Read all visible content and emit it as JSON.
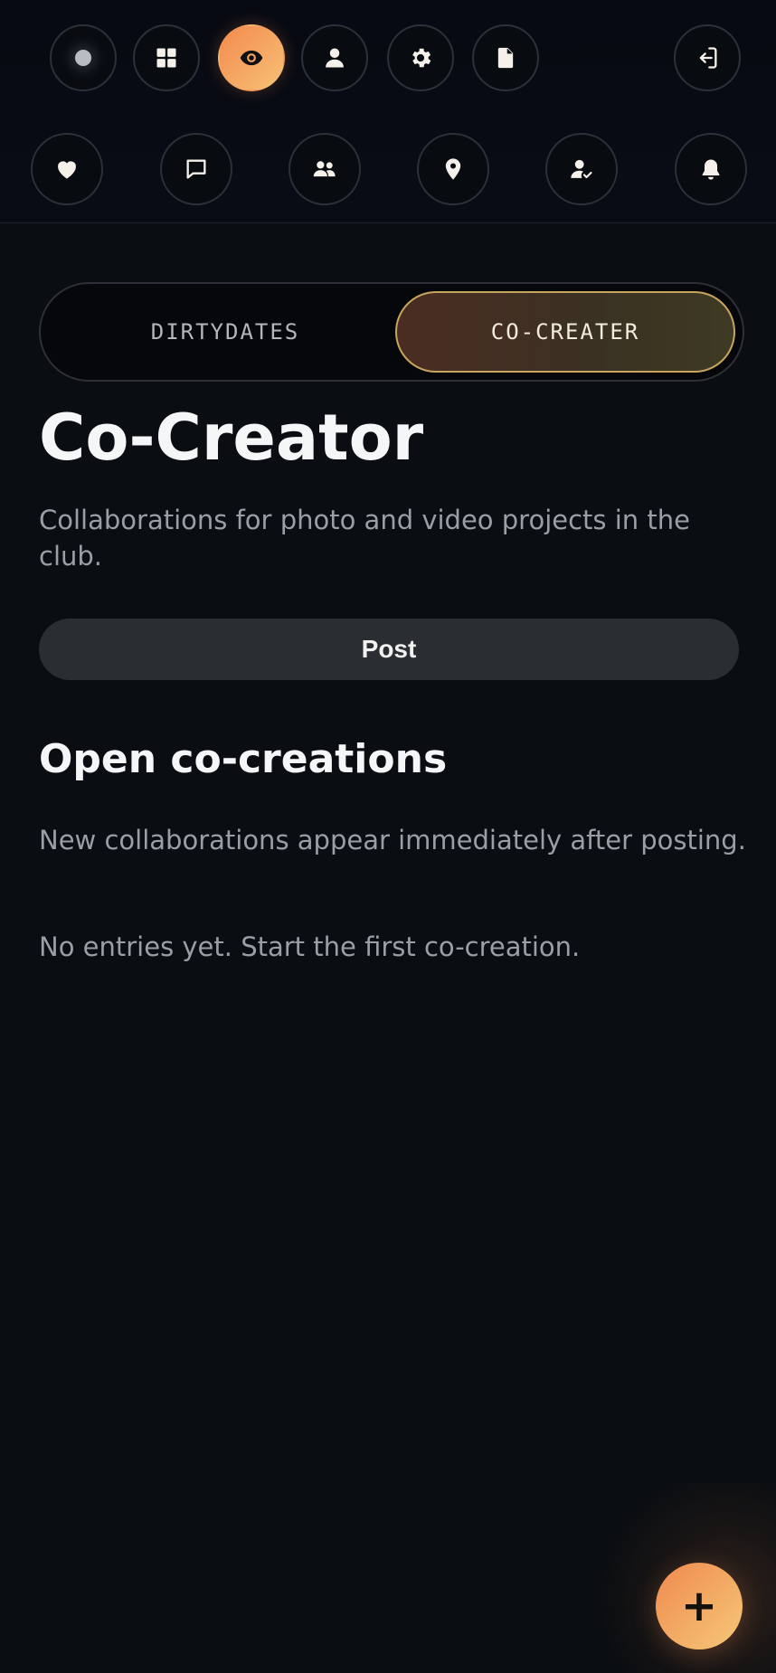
{
  "header": {
    "top_row": [
      {
        "name": "status-dot",
        "icon": "dot-icon"
      },
      {
        "name": "dashboard",
        "icon": "grid-icon"
      },
      {
        "name": "watch",
        "icon": "eye-icon",
        "active": true
      },
      {
        "name": "profile",
        "icon": "user-icon"
      },
      {
        "name": "settings",
        "icon": "gear-icon"
      },
      {
        "name": "documents",
        "icon": "file-icon"
      },
      {
        "name": "logout",
        "icon": "logout-icon"
      }
    ],
    "bottom_row": [
      {
        "name": "favorites",
        "icon": "heart-icon"
      },
      {
        "name": "messages",
        "icon": "chat-icon"
      },
      {
        "name": "members",
        "icon": "users-icon"
      },
      {
        "name": "location",
        "icon": "location-pin-icon"
      },
      {
        "name": "verified-user",
        "icon": "user-check-icon"
      },
      {
        "name": "notifications",
        "icon": "bell-icon"
      }
    ]
  },
  "toggle": {
    "left_label": "DIRTYDATES",
    "right_label": "CO-CREATER",
    "active": "right"
  },
  "main": {
    "title": "Co-Creator",
    "subtitle": "Collaborations for photo and video projects in the club.",
    "post_label": "Post",
    "section_title": "Open co-creations",
    "section_desc": "New collaborations appear immediately after posting.",
    "empty_text": "No entries yet. Start the first co-creation."
  },
  "fab": {
    "label": "+"
  },
  "colors": {
    "background": "#0a0d11",
    "accent_start": "#f48a4e",
    "accent_end": "#f6c176",
    "toggle_active_border": "#c8a55e",
    "muted_text": "#9a9ea5"
  }
}
